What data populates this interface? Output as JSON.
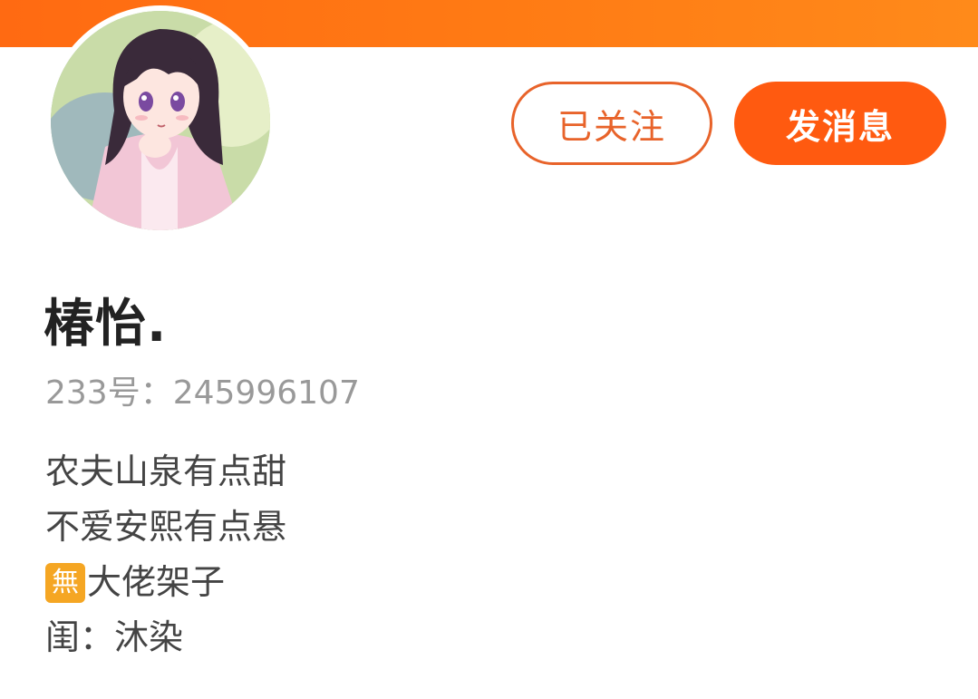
{
  "profile": {
    "name": "椿怡.",
    "uid_label": "233号：",
    "uid_value": "245996107"
  },
  "actions": {
    "follow_label": "已关注",
    "message_label": "发消息"
  },
  "bio": {
    "line1": "农夫山泉有点甜",
    "line2": "不爱安熙有点悬",
    "badge": "無",
    "line3": "大佬架子",
    "line4": "闺：沐染"
  },
  "colors": {
    "accent": "#ff5a10",
    "follow_border": "#e8632a",
    "badge": "#f5a623"
  },
  "icons": {
    "avatar": "anime-girl-avatar"
  }
}
